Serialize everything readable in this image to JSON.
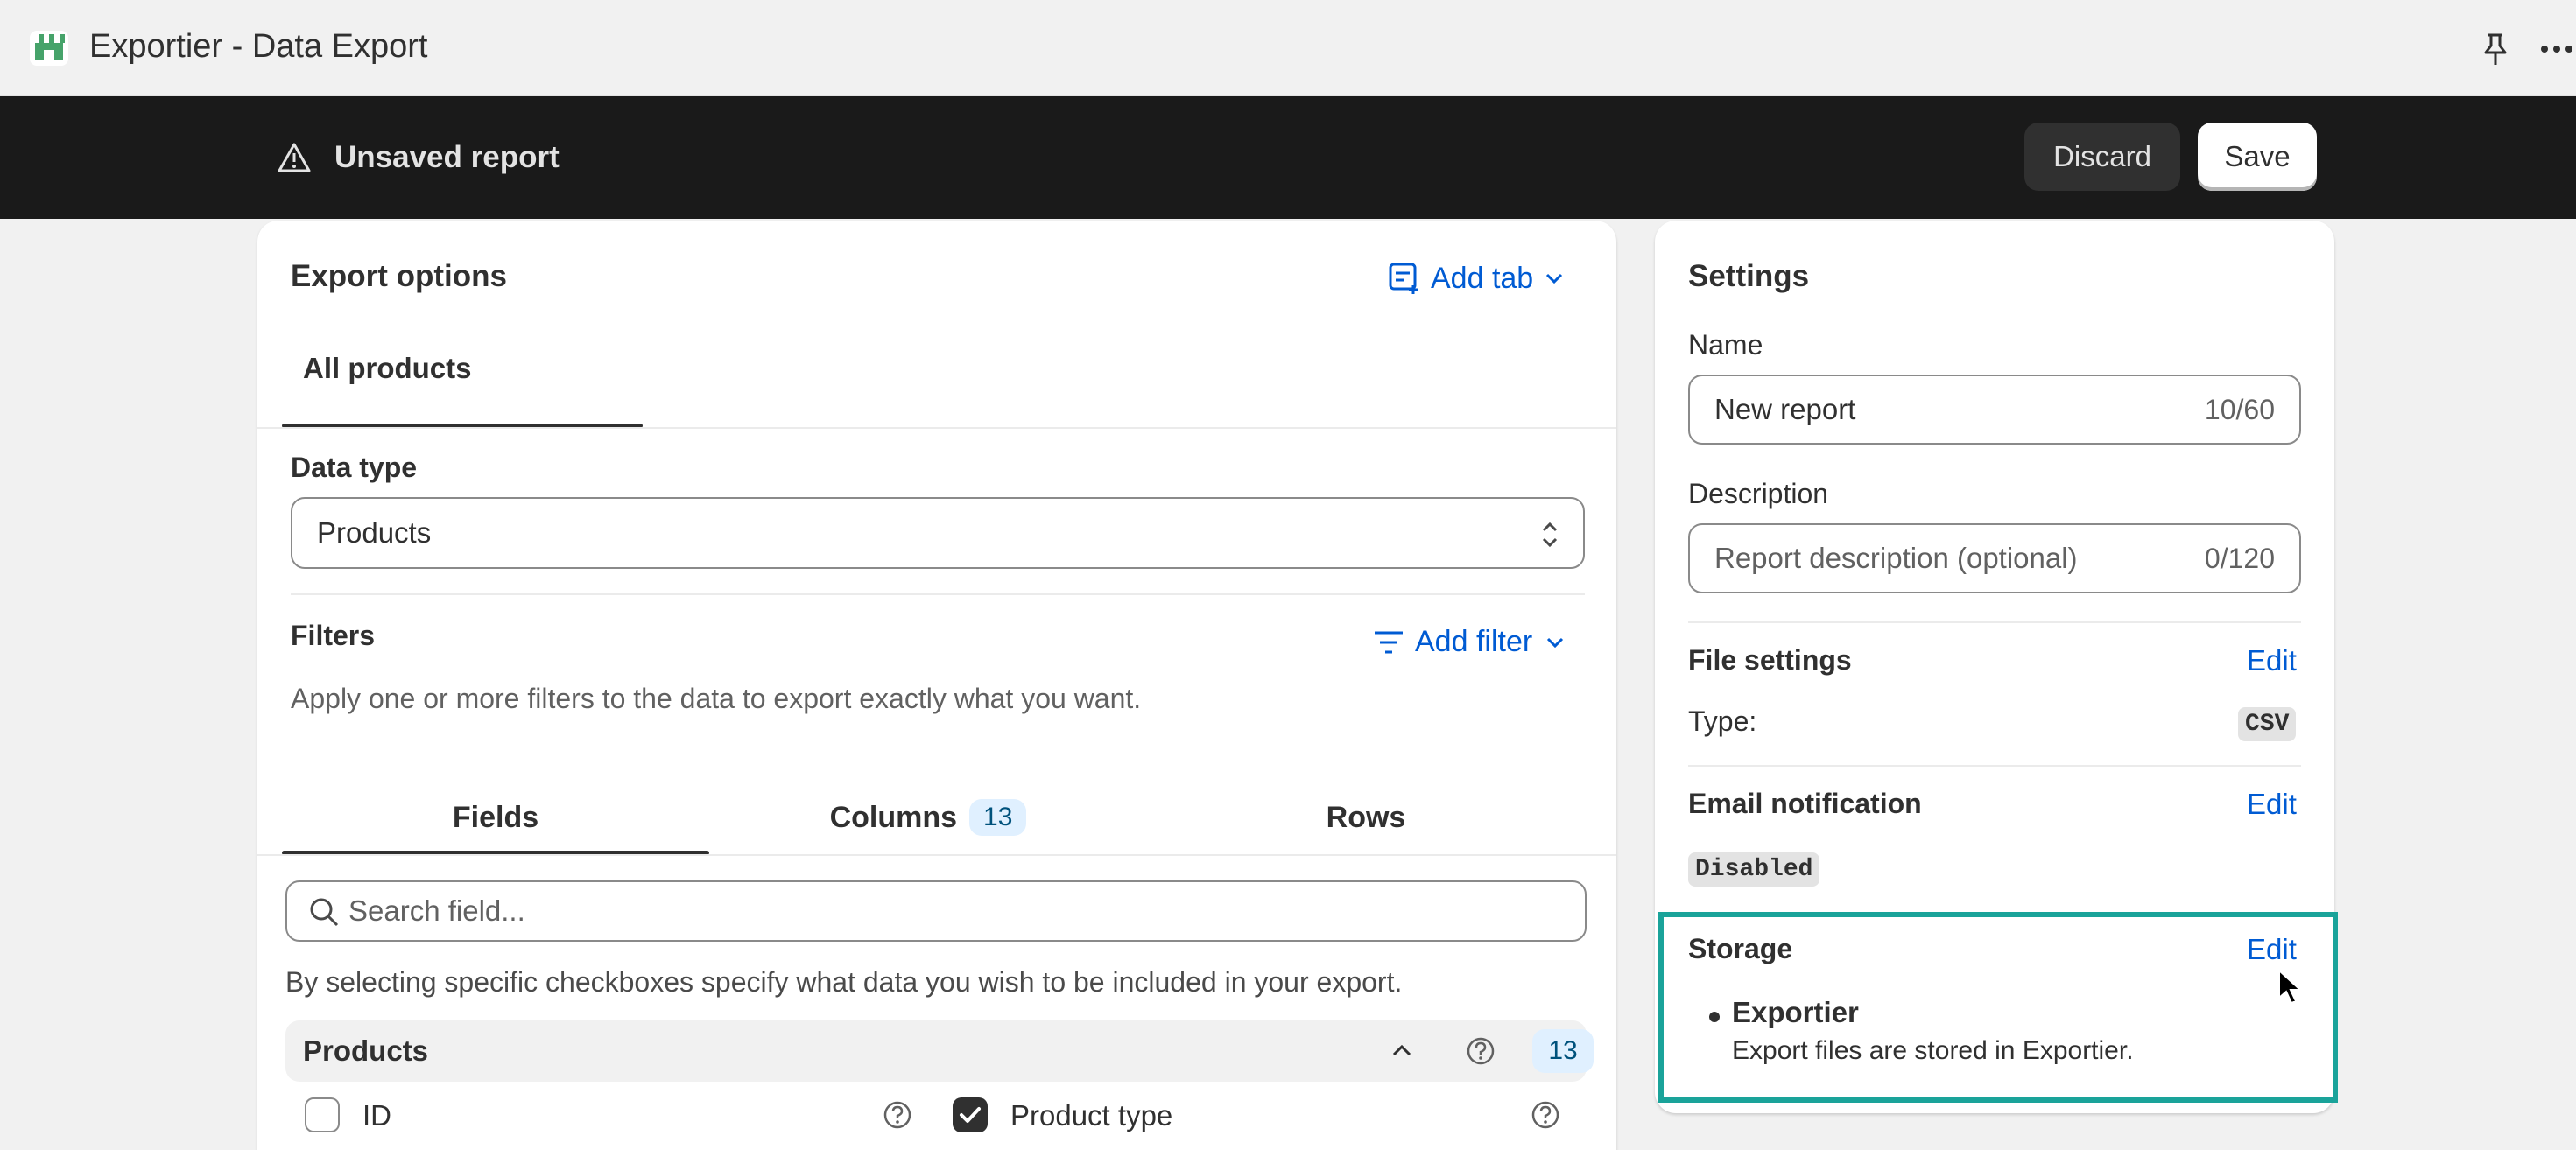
{
  "app": {
    "title": "Exportier - Data Export"
  },
  "save_bar": {
    "title": "Unsaved report",
    "discard_label": "Discard",
    "save_label": "Save"
  },
  "export_options": {
    "title": "Export options",
    "add_tab_label": "Add tab",
    "tabs": [
      {
        "label": "All products",
        "selected": true
      }
    ],
    "data_type": {
      "label": "Data type",
      "selected": "Products"
    },
    "filters": {
      "label": "Filters",
      "add_filter_label": "Add filter",
      "help": "Apply one or more filters to the data to export exactly what you want."
    },
    "subtabs": [
      {
        "label": "Fields",
        "selected": true
      },
      {
        "label": "Columns",
        "badge": "13"
      },
      {
        "label": "Rows"
      }
    ],
    "search": {
      "placeholder": "Search field..."
    },
    "fields_help": "By selecting specific checkboxes specify what data you wish to be included in your export.",
    "group": {
      "label": "Products",
      "count": "13"
    },
    "fields": [
      {
        "label": "ID",
        "checked": false
      },
      {
        "label": "Product type",
        "checked": true
      }
    ]
  },
  "settings": {
    "title": "Settings",
    "name": {
      "label": "Name",
      "value": "New report",
      "counter": "10/60"
    },
    "description": {
      "label": "Description",
      "placeholder": "Report description (optional)",
      "counter": "0/120"
    },
    "file_settings": {
      "title": "File settings",
      "edit_label": "Edit",
      "type_label": "Type:",
      "type_value": "CSV"
    },
    "email_notification": {
      "title": "Email notification",
      "edit_label": "Edit",
      "status": "Disabled"
    },
    "storage": {
      "title": "Storage",
      "edit_label": "Edit",
      "item_name": "Exportier",
      "item_desc": "Export files are stored in Exportier."
    }
  },
  "colors": {
    "accent": "#005bd3",
    "dark_bar": "#1a1a1a",
    "highlight": "#1aa39a"
  },
  "icons": [
    "store-icon",
    "pin-icon",
    "more-icon",
    "warning-icon",
    "add-tab-icon",
    "chevron-down-icon",
    "filter-icon",
    "select-arrows-icon",
    "search-icon",
    "chevron-up-icon",
    "help-icon",
    "checkmark-icon",
    "cursor-icon"
  ]
}
